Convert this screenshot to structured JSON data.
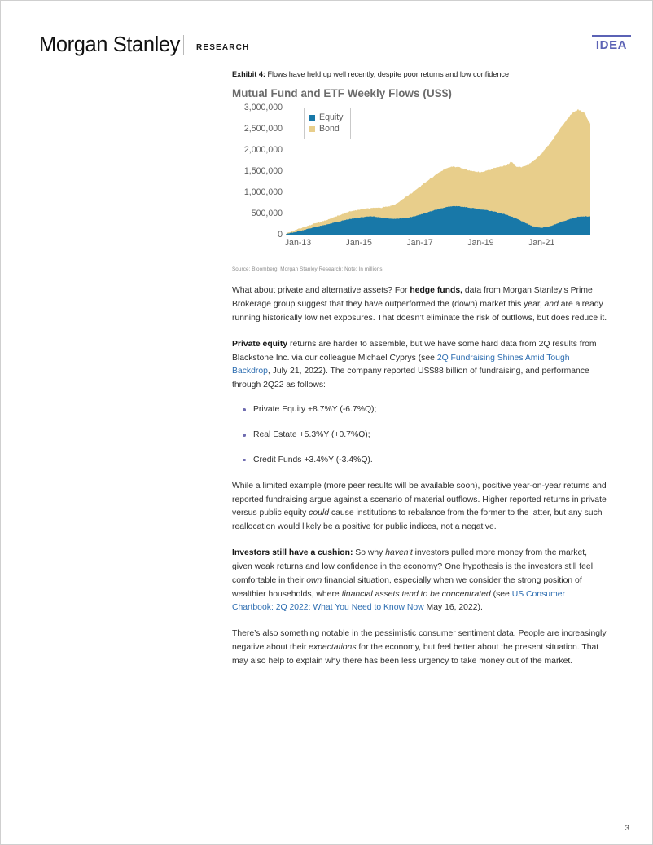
{
  "header": {
    "brand": "Morgan Stanley",
    "division": "RESEARCH",
    "badge": "IDEA"
  },
  "exhibit": {
    "label": "Exhibit 4:",
    "caption": "Flows have held up well recently, despite poor returns and low confidence",
    "chart_title": "Mutual Fund and ETF Weekly Flows (US$)",
    "source": "Source: Bloomberg, Morgan Stanley Research; Note: In millions."
  },
  "chart_data": {
    "type": "area",
    "title": "Mutual Fund and ETF Weekly Flows (US$)",
    "xlabel": "",
    "ylabel": "",
    "ylim": [
      0,
      3000000
    ],
    "ytick_labels": [
      "3,000,000",
      "2,500,000",
      "2,000,000",
      "1,500,000",
      "1,000,000",
      "500,000",
      "0"
    ],
    "ytick_values": [
      3000000,
      2500000,
      2000000,
      1500000,
      1000000,
      500000,
      0
    ],
    "xtick_labels": [
      "Jan-13",
      "Jan-15",
      "Jan-17",
      "Jan-19",
      "Jan-21"
    ],
    "xtick_values": [
      2013.0,
      2015.0,
      2017.0,
      2019.0,
      2021.0
    ],
    "xlim": [
      2012.6,
      2022.6
    ],
    "grid": false,
    "stacked": true,
    "legend": {
      "position": "top-left",
      "entries": [
        {
          "name": "Equity",
          "color": "#1878a8"
        },
        {
          "name": "Bond",
          "color": "#e8ce8b"
        }
      ]
    },
    "series": [
      {
        "name": "Equity",
        "color": "#1878a8",
        "x": [
          2012.6,
          2012.8,
          2013.0,
          2013.2,
          2013.4,
          2013.6,
          2013.8,
          2014.0,
          2014.2,
          2014.4,
          2014.6,
          2014.8,
          2015.0,
          2015.2,
          2015.4,
          2015.6,
          2015.8,
          2016.0,
          2016.2,
          2016.4,
          2016.6,
          2016.8,
          2017.0,
          2017.2,
          2017.4,
          2017.6,
          2017.8,
          2018.0,
          2018.2,
          2018.4,
          2018.6,
          2018.8,
          2019.0,
          2019.2,
          2019.4,
          2019.6,
          2019.8,
          2020.0,
          2020.2,
          2020.4,
          2020.6,
          2020.8,
          2021.0,
          2021.2,
          2021.4,
          2021.6,
          2021.8,
          2022.0,
          2022.2,
          2022.4,
          2022.6
        ],
        "values": [
          10000,
          45000,
          75000,
          110000,
          150000,
          185000,
          215000,
          250000,
          285000,
          320000,
          355000,
          380000,
          400000,
          420000,
          430000,
          420000,
          400000,
          380000,
          370000,
          385000,
          400000,
          430000,
          470000,
          520000,
          560000,
          600000,
          640000,
          665000,
          670000,
          660000,
          640000,
          620000,
          600000,
          575000,
          550000,
          520000,
          480000,
          430000,
          370000,
          300000,
          230000,
          180000,
          165000,
          185000,
          230000,
          290000,
          340000,
          385000,
          420000,
          430000,
          430000
        ]
      },
      {
        "name": "Bond",
        "color": "#e8ce8b",
        "x": [
          2012.6,
          2012.8,
          2013.0,
          2013.2,
          2013.4,
          2013.6,
          2013.8,
          2014.0,
          2014.2,
          2014.4,
          2014.6,
          2014.8,
          2015.0,
          2015.2,
          2015.4,
          2015.6,
          2015.8,
          2016.0,
          2016.2,
          2016.4,
          2016.6,
          2016.8,
          2017.0,
          2017.2,
          2017.4,
          2017.6,
          2017.8,
          2018.0,
          2018.2,
          2018.4,
          2018.6,
          2018.8,
          2019.0,
          2019.2,
          2019.4,
          2019.6,
          2019.8,
          2020.0,
          2020.2,
          2020.4,
          2020.6,
          2020.8,
          2021.0,
          2021.2,
          2021.4,
          2021.6,
          2021.8,
          2022.0,
          2022.2,
          2022.4,
          2022.6
        ],
        "values": [
          8000,
          30000,
          55000,
          70000,
          80000,
          85000,
          95000,
          110000,
          130000,
          150000,
          175000,
          185000,
          190000,
          190000,
          195000,
          215000,
          245000,
          290000,
          350000,
          430000,
          520000,
          590000,
          660000,
          730000,
          790000,
          850000,
          900000,
          930000,
          930000,
          900000,
          880000,
          870000,
          880000,
          930000,
          1010000,
          1080000,
          1140000,
          1290000,
          1220000,
          1300000,
          1450000,
          1600000,
          1750000,
          1900000,
          2050000,
          2200000,
          2350000,
          2480000,
          2530000,
          2450000,
          2180000
        ]
      }
    ]
  },
  "body": {
    "p1_a": "What about private and alternative assets? For ",
    "p1_bold": "hedge funds,",
    "p1_b": " data from Morgan Stanley’s Prime Brokerage group suggest that they have outperformed the (down) market this year, ",
    "p1_italic": "and",
    "p1_c": " are already running historically low net exposures. That doesn’t eliminate the risk of outflows, but does reduce it.",
    "p2_bold": "Private equity",
    "p2_a": " returns are harder to assemble, but we have some hard data from 2Q results from Blackstone Inc. via our colleague Michael Cyprys (see ",
    "p2_link": "2Q Fundraising Shines Amid Tough Backdrop",
    "p2_b": ", July 21, 2022). The company reported US$88 billion of fundraising, and performance through 2Q22 as follows:",
    "bullets": [
      "Private Equity +8.7%Y (-6.7%Q);",
      "Real Estate +5.3%Y (+0.7%Q);",
      "Credit Funds +3.4%Y (-3.4%Q)."
    ],
    "p3_a": "While a limited example (more peer results will be available soon), positive year-on-year returns and reported fundraising argue against a scenario of material outflows. Higher reported returns in private versus public equity ",
    "p3_italic": "could",
    "p3_b": " cause institutions to rebalance from the former to the latter, but any such reallocation would likely be a positive for public indices, not a negative.",
    "p4_bold": "Investors still have a cushion:",
    "p4_a": " So why ",
    "p4_italic1": "haven’t",
    "p4_b": " investors pulled more money from the market, given weak returns and low confidence in the economy? One hypothesis is the investors still feel comfortable in their ",
    "p4_italic2": "own",
    "p4_c": " financial situation, especially when we consider the strong position of wealthier households, where ",
    "p4_italic3": "financial assets tend to be concentrated",
    "p4_d": " (see ",
    "p4_link": "US Consumer Chartbook: 2Q 2022: What You Need to Know Now",
    "p4_e": " May 16, 2022).",
    "p5": "There’s also something notable in the pessimistic consumer sentiment data. People are increasingly negative about their ",
    "p5_italic": "expectations",
    "p5_b": " for the economy, but feel better about the present situation. That may also help to explain why there has been less urgency to take money out of the market."
  },
  "footer": {
    "page_number": "3"
  }
}
